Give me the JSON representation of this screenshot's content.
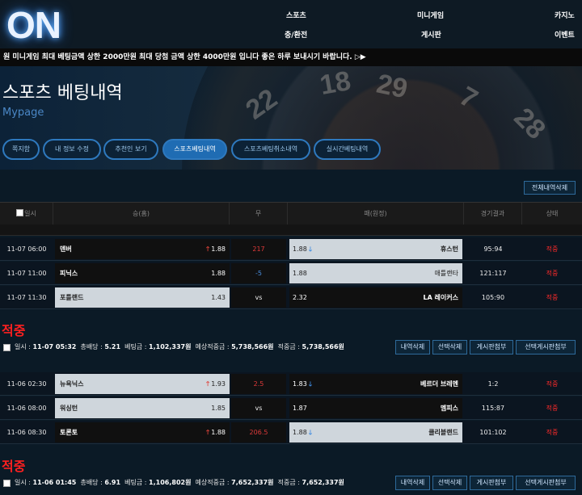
{
  "brand": {
    "logo": "ON"
  },
  "nav": {
    "sports": "스포츠",
    "minigame": "미니게임",
    "casino": "카지노",
    "charge": "충/환전",
    "board": "게시판",
    "event": "이벤트"
  },
  "ticker": {
    "text": "원 미니게임 최대 베팅금액 상한 2000만원 최대 당첨 금액 상한 4000만원 입니다 좋은 하루 보내시기 바랍니다. ▷▶"
  },
  "hero": {
    "title": "스포츠 베팅내역",
    "subtitle": "Mypage",
    "wheel_numbers": [
      "22",
      "18",
      "29",
      "7",
      "28"
    ]
  },
  "tabs": [
    {
      "label": "쪽지함",
      "active": false
    },
    {
      "label": "내 정보 수정",
      "active": false
    },
    {
      "label": "추천인 보기",
      "active": false
    },
    {
      "label": "스포츠베팅내역",
      "active": true
    },
    {
      "label": "스포츠베팅취소내역",
      "active": false
    },
    {
      "label": "실시간베팅내역",
      "active": false
    }
  ],
  "actions": {
    "delete_all": "전체내역삭제"
  },
  "table": {
    "headers": {
      "date": "일시",
      "win": "승(홈)",
      "draw": "무",
      "lose": "패(원정)",
      "result": "경기결과",
      "status": "상태"
    }
  },
  "slips": [
    {
      "rows": [
        {
          "time": "11-07 06:00",
          "home": "덴버",
          "home_odds": "1.88",
          "home_arrow": "up",
          "home_selected": false,
          "mid": "217",
          "mid_color": "red",
          "away": "휴스턴",
          "away_odds": "1.88",
          "away_arrow": "down",
          "away_selected": true,
          "score": "95:94",
          "status": "적중"
        },
        {
          "time": "11-07 11:00",
          "home": "피닉스",
          "home_odds": "1.88",
          "home_arrow": "",
          "home_selected": false,
          "mid": "-5",
          "mid_color": "blue",
          "away": "애틀랜타",
          "away_odds": "1.88",
          "away_arrow": "",
          "away_selected": true,
          "score": "121:117",
          "status": "적중"
        },
        {
          "time": "11-07 11:30",
          "home": "포틀랜드",
          "home_odds": "1.43",
          "home_arrow": "",
          "home_selected": true,
          "mid": "vs",
          "mid_color": "white",
          "away": "LA 레이커스",
          "away_odds": "2.32",
          "away_arrow": "",
          "away_selected": false,
          "score": "105:90",
          "status": "적중"
        }
      ],
      "result": "적중",
      "summary": {
        "date": "11-07 05:32",
        "total_odds": "5.21",
        "bet_amount": "1,102,337원",
        "expected_win": "5,738,566원",
        "win_amount": "5,738,566원"
      }
    },
    {
      "rows": [
        {
          "time": "11-06 02:30",
          "home": "뉴욕닉스",
          "home_odds": "1.93",
          "home_arrow": "up",
          "home_selected": true,
          "mid": "2.5",
          "mid_color": "red",
          "away": "베르더 브레멘",
          "away_odds": "1.83",
          "away_arrow": "down",
          "away_selected": false,
          "score": "1:2",
          "status": "적중"
        },
        {
          "time": "11-06 08:00",
          "home": "워싱턴",
          "home_odds": "1.85",
          "home_arrow": "",
          "home_selected": true,
          "mid": "vs",
          "mid_color": "white",
          "away": "멤피스",
          "away_odds": "1.87",
          "away_arrow": "",
          "away_selected": false,
          "score": "115:87",
          "status": "적중"
        },
        {
          "time": "11-06 08:30",
          "home": "토론토",
          "home_odds": "1.88",
          "home_arrow": "up",
          "home_selected": false,
          "mid": "206.5",
          "mid_color": "red",
          "away": "클리블랜드",
          "away_odds": "1.88",
          "away_arrow": "down",
          "away_selected": true,
          "score": "101:102",
          "status": "적중"
        }
      ],
      "result": "적중",
      "summary": {
        "date": "11-06 01:45",
        "total_odds": "6.91",
        "bet_amount": "1,106,802원",
        "expected_win": "7,652,337원",
        "win_amount": "7,652,337원"
      }
    }
  ],
  "labels": {
    "date": "일시 : ",
    "total_odds": "총배당 : ",
    "bet_amount": "베팅금 : ",
    "expected_win": "예상적중금 : ",
    "win_amount": "적중금 : ",
    "delete_slip": "내역삭제",
    "delete_selected": "선택삭제",
    "board_attach": "게시판첨부",
    "board_attach_selected": "선택게시판첨부"
  }
}
